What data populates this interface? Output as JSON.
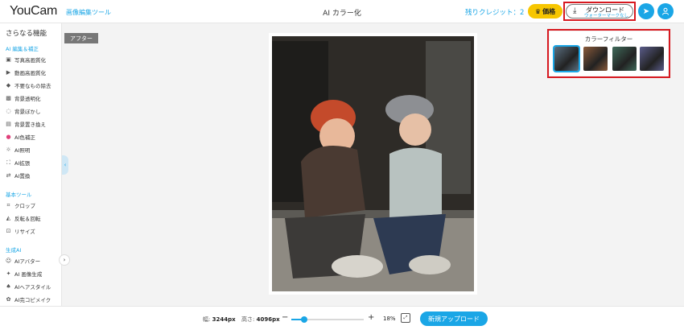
{
  "app": {
    "logo": "YouCam",
    "logo_sub": "画像編集ツール",
    "title": "AI カラー化"
  },
  "header": {
    "credits": "残りクレジット：2",
    "price_label": "価格",
    "download_label": "ダウンロード",
    "download_sub": "ウォーターマークなし",
    "icons": [
      "crown-icon",
      "download-icon",
      "send-icon",
      "user-icon"
    ]
  },
  "sidebar": {
    "title": "さらなる機能",
    "sections": [
      {
        "label": "AI 編集＆補正",
        "items": [
          {
            "label": "写真高画質化",
            "icon": "image-enhance-icon"
          },
          {
            "label": "動画高画質化",
            "icon": "video-enhance-icon"
          },
          {
            "label": "不要なもの除去",
            "icon": "eraser-icon"
          },
          {
            "label": "背景透明化",
            "icon": "transparent-bg-icon"
          },
          {
            "label": "背景ぼかし",
            "icon": "blur-icon"
          },
          {
            "label": "背景置き換え",
            "icon": "replace-bg-icon"
          },
          {
            "label": "AI色補正",
            "icon": "color-wheel-icon"
          },
          {
            "label": "AI照明",
            "icon": "light-icon"
          },
          {
            "label": "AI拡張",
            "icon": "expand-icon"
          },
          {
            "label": "AI置換",
            "icon": "swap-icon"
          }
        ]
      },
      {
        "label": "基本ツール",
        "items": [
          {
            "label": "クロップ",
            "icon": "crop-icon"
          },
          {
            "label": "反転＆回転",
            "icon": "flip-icon"
          },
          {
            "label": "リサイズ",
            "icon": "resize-icon"
          }
        ]
      },
      {
        "label": "生成AI",
        "items": [
          {
            "label": "AIアバター",
            "icon": "avatar-icon"
          },
          {
            "label": "AI 画像生成",
            "icon": "image-gen-icon"
          },
          {
            "label": "AIヘアスタイル",
            "icon": "hair-icon"
          },
          {
            "label": "AI完コピメイク",
            "icon": "makeup-icon"
          }
        ]
      }
    ]
  },
  "canvas": {
    "after_label": "アフター"
  },
  "filters": {
    "title": "カラーフィルター",
    "thumb_label": "",
    "selected_index": 0,
    "colors": [
      "#5a6f80",
      "#8a5a3a",
      "#3f6a5a",
      "#5a5c8a"
    ]
  },
  "footer": {
    "width_label": "幅:",
    "width_value": "3244px",
    "height_label": "高さ:",
    "height_value": "4096px",
    "zoom_percent": 18,
    "zoom_text": "18%",
    "upload_label": "新規アップロード"
  },
  "colors": {
    "accent": "#1aa6e6",
    "price": "#f7c600",
    "highlight": "#d71920"
  }
}
